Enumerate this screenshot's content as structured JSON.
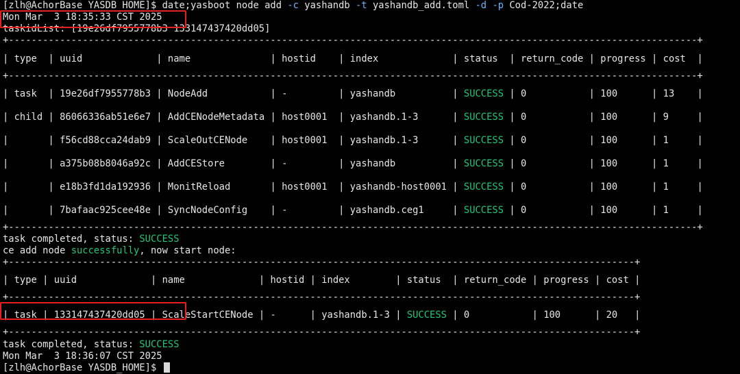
{
  "prompt": {
    "text": "[zlh@AchorBase YASDB_HOME]$ ",
    "cmd_a": "date;yasboot node add ",
    "flag_c": "-c",
    "cmd_b": " yashandb ",
    "flag_t": "-t",
    "cmd_c": " yashandb_add.toml ",
    "flag_d": "-d",
    "cmd_d": " ",
    "flag_p": "-p",
    "cmd_e": " Cod-2022;date"
  },
  "date_start": "Mon Mar  3 18:35:33 CST 2025",
  "taskid_list": "taskidList: [19e26df7955778b3 133147437420dd05]",
  "table1": {
    "border_top": "+----------------------------------------------------------------------------------------------------------------------------+",
    "border_mid": "+----------------------------------------------------------------------------------------------------------------------------+",
    "header": [
      "type",
      "uuid",
      "name",
      "hostid",
      "index",
      "status",
      "return_code",
      "progress",
      "cost"
    ],
    "rows": [
      {
        "type": "task",
        "uuid": "19e26df7955778b3",
        "name": "NodeAdd",
        "hostid": "-",
        "index": "yashandb",
        "status": "SUCCESS",
        "return_code": "0",
        "progress": "100",
        "cost": "13"
      },
      {
        "type": "child",
        "uuid": "86066336ab51e6e7",
        "name": "AddCENodeMetadata",
        "hostid": "host0001",
        "index": "yashandb.1-3",
        "status": "SUCCESS",
        "return_code": "0",
        "progress": "100",
        "cost": "9"
      },
      {
        "type": "",
        "uuid": "f56cd88cca24dab9",
        "name": "ScaleOutCENode",
        "hostid": "host0001",
        "index": "yashandb.1-3",
        "status": "SUCCESS",
        "return_code": "0",
        "progress": "100",
        "cost": "1"
      },
      {
        "type": "",
        "uuid": "a375b08b8046a92c",
        "name": "AddCEStore",
        "hostid": "-",
        "index": "yashandb",
        "status": "SUCCESS",
        "return_code": "0",
        "progress": "100",
        "cost": "1"
      },
      {
        "type": "",
        "uuid": "e18b3fd1da192936",
        "name": "MonitReload",
        "hostid": "host0001",
        "index": "yashandb-host0001",
        "status": "SUCCESS",
        "return_code": "0",
        "progress": "100",
        "cost": "1"
      },
      {
        "type": "",
        "uuid": "7bafaac925cee48e",
        "name": "SyncNodeConfig",
        "hostid": "-",
        "index": "yashandb.ceg1",
        "status": "SUCCESS",
        "return_code": "0",
        "progress": "100",
        "cost": "1"
      }
    ]
  },
  "task_completed_1": {
    "prefix": "task completed, status: ",
    "status": "SUCCESS"
  },
  "ce_add": {
    "a": "ce add node ",
    "b": "successfully",
    "c": ", now start node:"
  },
  "table2": {
    "header": [
      "type",
      "uuid",
      "name",
      "hostid",
      "index",
      "status",
      "return_code",
      "progress",
      "cost"
    ],
    "rows": [
      {
        "type": "task",
        "uuid": "133147437420dd05",
        "name": "ScaleStartCENode",
        "hostid": "-",
        "index": "yashandb.1-3",
        "status": "SUCCESS",
        "return_code": "0",
        "progress": "100",
        "cost": "20"
      }
    ]
  },
  "task_completed_2": {
    "prefix": "task completed, status: ",
    "status": "SUCCESS"
  },
  "date_end": "Mon Mar  3 18:36:07 CST 2025",
  "final_prompt": "[zlh@AchorBase YASDB_HOME]$ ",
  "colors": {
    "success": "#1ec77a",
    "flag": "#6cb4ff",
    "highlight": "#e8201c",
    "bg": "#000000"
  }
}
